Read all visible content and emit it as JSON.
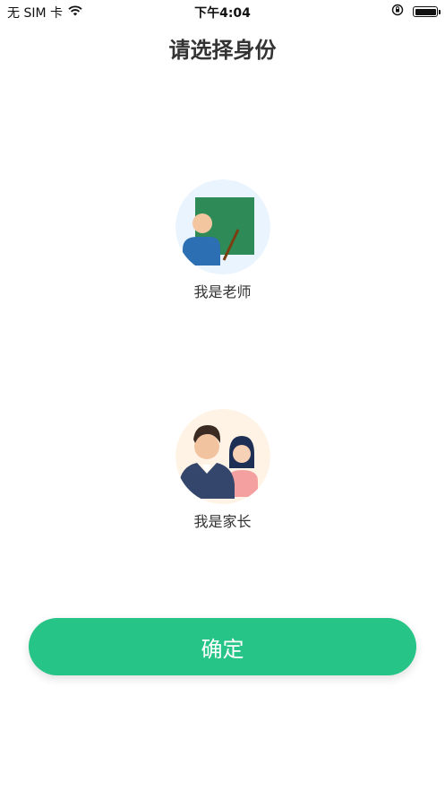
{
  "status_bar": {
    "carrier": "无 SIM 卡",
    "time": "下午4:04",
    "icons": [
      "wifi-icon",
      "rotation-lock-icon",
      "battery-icon"
    ]
  },
  "page": {
    "title": "请选择身份"
  },
  "roles": [
    {
      "label": "我是老师",
      "icon": "teacher-icon",
      "bg": "#eaf4ff"
    },
    {
      "label": "我是家长",
      "icon": "parents-icon",
      "bg": "#fff3e6"
    }
  ],
  "confirm": {
    "label": "确定",
    "color": "#26c486"
  }
}
